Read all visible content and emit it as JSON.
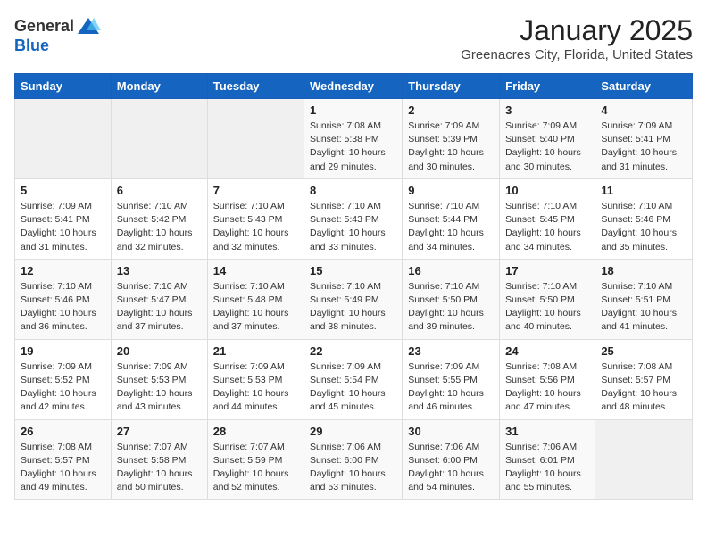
{
  "logo": {
    "general": "General",
    "blue": "Blue"
  },
  "header": {
    "month": "January 2025",
    "location": "Greenacres City, Florida, United States"
  },
  "weekdays": [
    "Sunday",
    "Monday",
    "Tuesday",
    "Wednesday",
    "Thursday",
    "Friday",
    "Saturday"
  ],
  "weeks": [
    [
      {
        "day": "",
        "info": ""
      },
      {
        "day": "",
        "info": ""
      },
      {
        "day": "",
        "info": ""
      },
      {
        "day": "1",
        "info": "Sunrise: 7:08 AM\nSunset: 5:38 PM\nDaylight: 10 hours\nand 29 minutes."
      },
      {
        "day": "2",
        "info": "Sunrise: 7:09 AM\nSunset: 5:39 PM\nDaylight: 10 hours\nand 30 minutes."
      },
      {
        "day": "3",
        "info": "Sunrise: 7:09 AM\nSunset: 5:40 PM\nDaylight: 10 hours\nand 30 minutes."
      },
      {
        "day": "4",
        "info": "Sunrise: 7:09 AM\nSunset: 5:41 PM\nDaylight: 10 hours\nand 31 minutes."
      }
    ],
    [
      {
        "day": "5",
        "info": "Sunrise: 7:09 AM\nSunset: 5:41 PM\nDaylight: 10 hours\nand 31 minutes."
      },
      {
        "day": "6",
        "info": "Sunrise: 7:10 AM\nSunset: 5:42 PM\nDaylight: 10 hours\nand 32 minutes."
      },
      {
        "day": "7",
        "info": "Sunrise: 7:10 AM\nSunset: 5:43 PM\nDaylight: 10 hours\nand 32 minutes."
      },
      {
        "day": "8",
        "info": "Sunrise: 7:10 AM\nSunset: 5:43 PM\nDaylight: 10 hours\nand 33 minutes."
      },
      {
        "day": "9",
        "info": "Sunrise: 7:10 AM\nSunset: 5:44 PM\nDaylight: 10 hours\nand 34 minutes."
      },
      {
        "day": "10",
        "info": "Sunrise: 7:10 AM\nSunset: 5:45 PM\nDaylight: 10 hours\nand 34 minutes."
      },
      {
        "day": "11",
        "info": "Sunrise: 7:10 AM\nSunset: 5:46 PM\nDaylight: 10 hours\nand 35 minutes."
      }
    ],
    [
      {
        "day": "12",
        "info": "Sunrise: 7:10 AM\nSunset: 5:46 PM\nDaylight: 10 hours\nand 36 minutes."
      },
      {
        "day": "13",
        "info": "Sunrise: 7:10 AM\nSunset: 5:47 PM\nDaylight: 10 hours\nand 37 minutes."
      },
      {
        "day": "14",
        "info": "Sunrise: 7:10 AM\nSunset: 5:48 PM\nDaylight: 10 hours\nand 37 minutes."
      },
      {
        "day": "15",
        "info": "Sunrise: 7:10 AM\nSunset: 5:49 PM\nDaylight: 10 hours\nand 38 minutes."
      },
      {
        "day": "16",
        "info": "Sunrise: 7:10 AM\nSunset: 5:50 PM\nDaylight: 10 hours\nand 39 minutes."
      },
      {
        "day": "17",
        "info": "Sunrise: 7:10 AM\nSunset: 5:50 PM\nDaylight: 10 hours\nand 40 minutes."
      },
      {
        "day": "18",
        "info": "Sunrise: 7:10 AM\nSunset: 5:51 PM\nDaylight: 10 hours\nand 41 minutes."
      }
    ],
    [
      {
        "day": "19",
        "info": "Sunrise: 7:09 AM\nSunset: 5:52 PM\nDaylight: 10 hours\nand 42 minutes."
      },
      {
        "day": "20",
        "info": "Sunrise: 7:09 AM\nSunset: 5:53 PM\nDaylight: 10 hours\nand 43 minutes."
      },
      {
        "day": "21",
        "info": "Sunrise: 7:09 AM\nSunset: 5:53 PM\nDaylight: 10 hours\nand 44 minutes."
      },
      {
        "day": "22",
        "info": "Sunrise: 7:09 AM\nSunset: 5:54 PM\nDaylight: 10 hours\nand 45 minutes."
      },
      {
        "day": "23",
        "info": "Sunrise: 7:09 AM\nSunset: 5:55 PM\nDaylight: 10 hours\nand 46 minutes."
      },
      {
        "day": "24",
        "info": "Sunrise: 7:08 AM\nSunset: 5:56 PM\nDaylight: 10 hours\nand 47 minutes."
      },
      {
        "day": "25",
        "info": "Sunrise: 7:08 AM\nSunset: 5:57 PM\nDaylight: 10 hours\nand 48 minutes."
      }
    ],
    [
      {
        "day": "26",
        "info": "Sunrise: 7:08 AM\nSunset: 5:57 PM\nDaylight: 10 hours\nand 49 minutes."
      },
      {
        "day": "27",
        "info": "Sunrise: 7:07 AM\nSunset: 5:58 PM\nDaylight: 10 hours\nand 50 minutes."
      },
      {
        "day": "28",
        "info": "Sunrise: 7:07 AM\nSunset: 5:59 PM\nDaylight: 10 hours\nand 52 minutes."
      },
      {
        "day": "29",
        "info": "Sunrise: 7:06 AM\nSunset: 6:00 PM\nDaylight: 10 hours\nand 53 minutes."
      },
      {
        "day": "30",
        "info": "Sunrise: 7:06 AM\nSunset: 6:00 PM\nDaylight: 10 hours\nand 54 minutes."
      },
      {
        "day": "31",
        "info": "Sunrise: 7:06 AM\nSunset: 6:01 PM\nDaylight: 10 hours\nand 55 minutes."
      },
      {
        "day": "",
        "info": ""
      }
    ]
  ]
}
